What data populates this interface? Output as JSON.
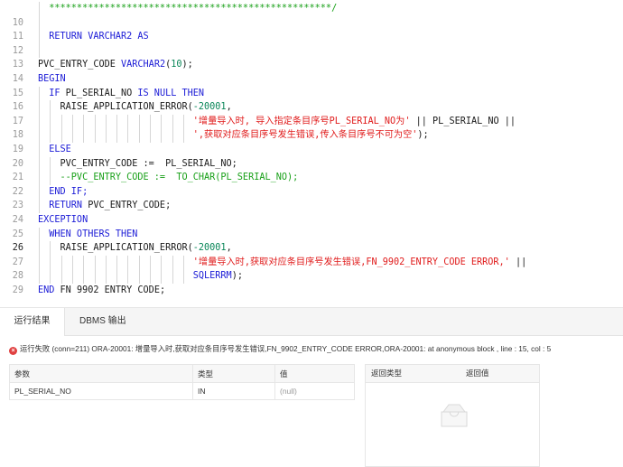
{
  "editor": {
    "lines": [
      {
        "num": "",
        "guides": 1,
        "tokens": [
          {
            "t": "  ***************************************************/",
            "c": "cmt"
          }
        ]
      },
      {
        "num": "10",
        "guides": 1,
        "tokens": []
      },
      {
        "num": "11",
        "guides": 1,
        "tokens": [
          {
            "t": "  RETURN VARCHAR2 AS",
            "c": "kw"
          }
        ]
      },
      {
        "num": "12",
        "guides": 1,
        "tokens": []
      },
      {
        "num": "13",
        "guides": 0,
        "tokens": [
          {
            "t": "PVC_ENTRY_CODE ",
            "c": "id"
          },
          {
            "t": "VARCHAR2",
            "c": "kw"
          },
          {
            "t": "(",
            "c": "id"
          },
          {
            "t": "10",
            "c": "num"
          },
          {
            "t": ");",
            "c": "id"
          }
        ]
      },
      {
        "num": "14",
        "guides": 0,
        "tokens": [
          {
            "t": "BEGIN",
            "c": "kw"
          }
        ]
      },
      {
        "num": "15",
        "guides": 1,
        "tokens": [
          {
            "t": "  IF ",
            "c": "kw"
          },
          {
            "t": "PL_SERIAL_NO ",
            "c": "id"
          },
          {
            "t": "IS NULL THEN",
            "c": "kw"
          }
        ]
      },
      {
        "num": "16",
        "guides": 2,
        "tokens": [
          {
            "t": "    RAISE_APPLICATION_ERROR(",
            "c": "id"
          },
          {
            "t": "-20001",
            "c": "num"
          },
          {
            "t": ",",
            "c": "id"
          }
        ]
      },
      {
        "num": "17",
        "guides": 14,
        "tokens": [
          {
            "t": "                            ",
            "c": "id"
          },
          {
            "t": "'增量导入时, 导入指定条目序号PL_SERIAL_NO为'",
            "c": "str"
          },
          {
            "t": " || PL_SERIAL_NO ||",
            "c": "id"
          }
        ]
      },
      {
        "num": "18",
        "guides": 14,
        "tokens": [
          {
            "t": "                            ",
            "c": "id"
          },
          {
            "t": "',获取对应条目序号发生错误,传入条目序号不可为空'",
            "c": "str"
          },
          {
            "t": ");",
            "c": "id"
          }
        ]
      },
      {
        "num": "19",
        "guides": 1,
        "tokens": [
          {
            "t": "  ELSE",
            "c": "kw"
          }
        ]
      },
      {
        "num": "20",
        "guides": 2,
        "tokens": [
          {
            "t": "    PVC_ENTRY_CODE :=  PL_SERIAL_NO;",
            "c": "id"
          }
        ]
      },
      {
        "num": "21",
        "guides": 2,
        "tokens": [
          {
            "t": "    --PVC_ENTRY_CODE :=  TO_CHAR(PL_SERIAL_NO);",
            "c": "cmt"
          }
        ]
      },
      {
        "num": "22",
        "guides": 1,
        "tokens": [
          {
            "t": "  END IF;",
            "c": "kw"
          }
        ]
      },
      {
        "num": "23",
        "guides": 1,
        "tokens": [
          {
            "t": "  RETURN ",
            "c": "kw"
          },
          {
            "t": "PVC_ENTRY_CODE;",
            "c": "id"
          }
        ]
      },
      {
        "num": "24",
        "guides": 0,
        "tokens": [
          {
            "t": "EXCEPTION",
            "c": "kw"
          }
        ]
      },
      {
        "num": "25",
        "guides": 1,
        "tokens": [
          {
            "t": "  WHEN OTHERS THEN",
            "c": "kw"
          }
        ]
      },
      {
        "num": "26",
        "guides": 2,
        "tokens": [
          {
            "t": "    RAISE_APPLICATION_ERROR(",
            "c": "id"
          },
          {
            "t": "-20001",
            "c": "num"
          },
          {
            "t": ",",
            "c": "id"
          }
        ]
      },
      {
        "num": "27",
        "guides": 14,
        "tokens": [
          {
            "t": "                            ",
            "c": "id"
          },
          {
            "t": "'增量导入时,获取对应条目序号发生错误,FN_9902_ENTRY_CODE ERROR,'",
            "c": "str"
          },
          {
            "t": " ||",
            "c": "id"
          }
        ]
      },
      {
        "num": "28",
        "guides": 14,
        "tokens": [
          {
            "t": "                            ",
            "c": "id"
          },
          {
            "t": "SQLERRM",
            "c": "kw"
          },
          {
            "t": ");",
            "c": "id"
          }
        ]
      },
      {
        "num": "29",
        "guides": 0,
        "tokens": [
          {
            "t": "END ",
            "c": "kw"
          },
          {
            "t": "FN_9902_ENTRY_CODE;",
            "c": "id"
          }
        ]
      }
    ],
    "current_line": "26"
  },
  "panel": {
    "tabs": [
      {
        "label": "运行结果",
        "active": true
      },
      {
        "label": "DBMS 输出",
        "active": false
      }
    ],
    "status_icon": "error-icon",
    "status_text": "运行失败 (conn=211) ORA-20001: 增量导入时,获取对应条目序号发生错误,FN_9902_ENTRY_CODE ERROR,ORA-20001: at anonymous block , line : 15, col : 5",
    "params_table": {
      "headers": [
        "参数",
        "类型",
        "值"
      ],
      "rows": [
        [
          "PL_SERIAL_NO",
          "IN",
          "(null)"
        ]
      ]
    },
    "return_table": {
      "headers": [
        "返回类型",
        "返回值"
      ],
      "empty_icon": "empty-box-icon"
    }
  },
  "colors": {
    "keyword": "#1b1bd6",
    "string": "#e01b1b",
    "comment": "#18a018",
    "number": "#098658",
    "error": "#e04040"
  }
}
